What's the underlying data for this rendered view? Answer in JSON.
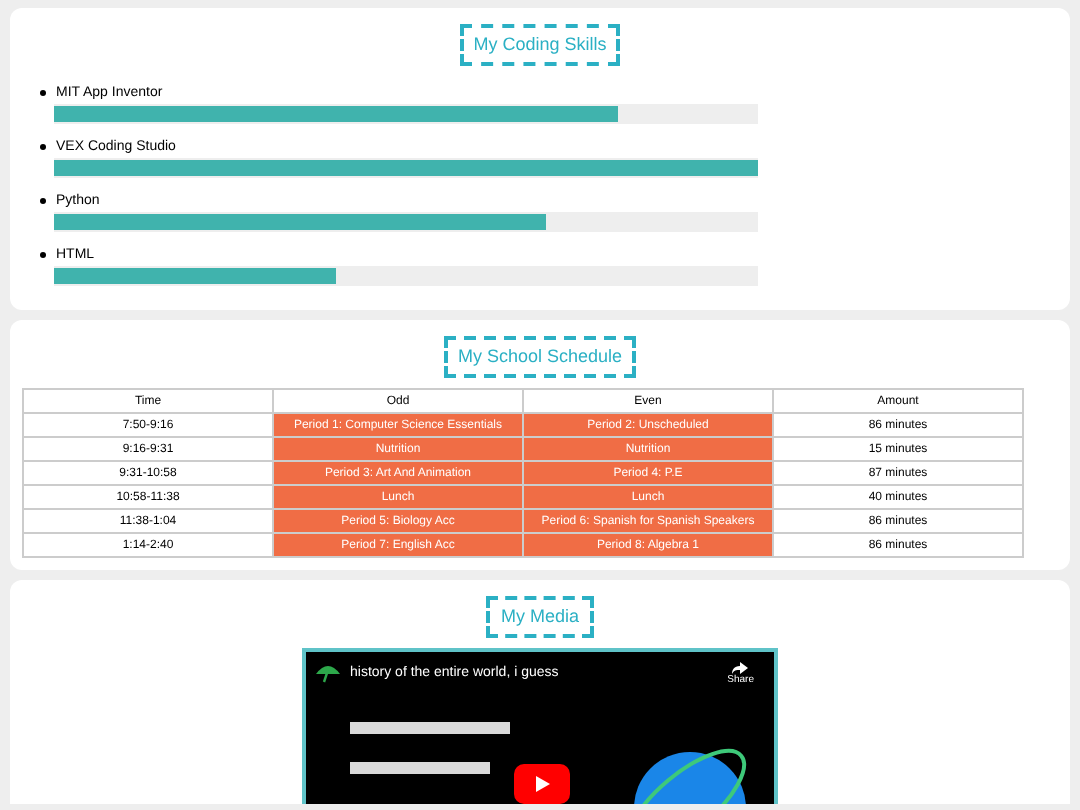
{
  "skills": {
    "title": "My Coding Skills",
    "items": [
      {
        "name": "MIT App Inventor",
        "level": 0.8
      },
      {
        "name": "VEX Coding Studio",
        "level": 1.0
      },
      {
        "name": "Python",
        "level": 0.7
      },
      {
        "name": "HTML",
        "level": 0.4
      }
    ]
  },
  "schedule": {
    "title": "My School Schedule",
    "columns": [
      "Time",
      "Odd",
      "Even",
      "Amount"
    ],
    "rows": [
      [
        "7:50-9:16",
        "Period 1: Computer Science Essentials",
        "Period 2: Unscheduled",
        "86 minutes"
      ],
      [
        "9:16-9:31",
        "Nutrition",
        "Nutrition",
        "15 minutes"
      ],
      [
        "9:31-10:58",
        "Period 3: Art And Animation",
        "Period 4: P.E",
        "87 minutes"
      ],
      [
        "10:58-11:38",
        "Lunch",
        "Lunch",
        "40 minutes"
      ],
      [
        "11:38-1:04",
        "Period 5: Biology Acc",
        "Period 6: Spanish for Spanish Speakers",
        "86 minutes"
      ],
      [
        "1:14-2:40",
        "Period 7: English Acc",
        "Period 8: Algebra 1",
        "86 minutes"
      ]
    ]
  },
  "media": {
    "title": "My Media",
    "video": {
      "title": "history of the entire world, i guess",
      "share": "Share",
      "kind": "picture"
    }
  }
}
